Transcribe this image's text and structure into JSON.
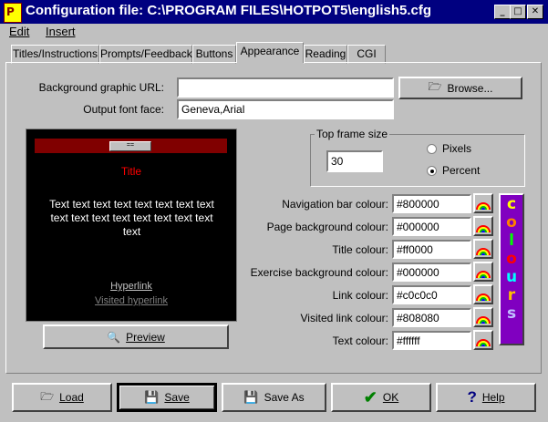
{
  "window": {
    "title": "Configuration file: C:\\PROGRAM FILES\\HOTPOT5\\english5.cfg",
    "app_icon_letter": "P"
  },
  "menu": [
    "Edit",
    "Insert"
  ],
  "tabs": [
    "Titles/Instructions",
    "Prompts/Feedback",
    "Buttons",
    "Appearance",
    "Reading",
    "CGI"
  ],
  "active_tab": "Appearance",
  "bg_url": {
    "label": "Background graphic URL:",
    "value": ""
  },
  "browse_label": "Browse...",
  "font_face": {
    "label": "Output font face:",
    "value": "Geneva,Arial"
  },
  "preview_box": {
    "nav_button": "==",
    "title": "Title",
    "body": "Text text text text text text text text text text text text text text text text text",
    "link": "Hyperlink",
    "visited_link": "Visited hyperlink"
  },
  "preview_button": "Preview",
  "top_frame": {
    "legend": "Top frame size",
    "value": "30",
    "options": [
      "Pixels",
      "Percent"
    ],
    "selected": "Percent"
  },
  "colours": [
    {
      "label": "Navigation bar colour:",
      "value": "#800000"
    },
    {
      "label": "Page background colour:",
      "value": "#000000"
    },
    {
      "label": "Title colour:",
      "value": "#ff0000"
    },
    {
      "label": "Exercise background colour:",
      "value": "#000000"
    },
    {
      "label": "Link colour:",
      "value": "#c0c0c0"
    },
    {
      "label": "Visited link colour:",
      "value": "#808080"
    },
    {
      "label": "Text colour:",
      "value": "#ffffff"
    }
  ],
  "colours_button_letters": [
    "c",
    "o",
    "l",
    "o",
    "u",
    "r",
    "s"
  ],
  "bottom_buttons": [
    "Load",
    "Save",
    "Save As",
    "OK",
    "Help"
  ]
}
